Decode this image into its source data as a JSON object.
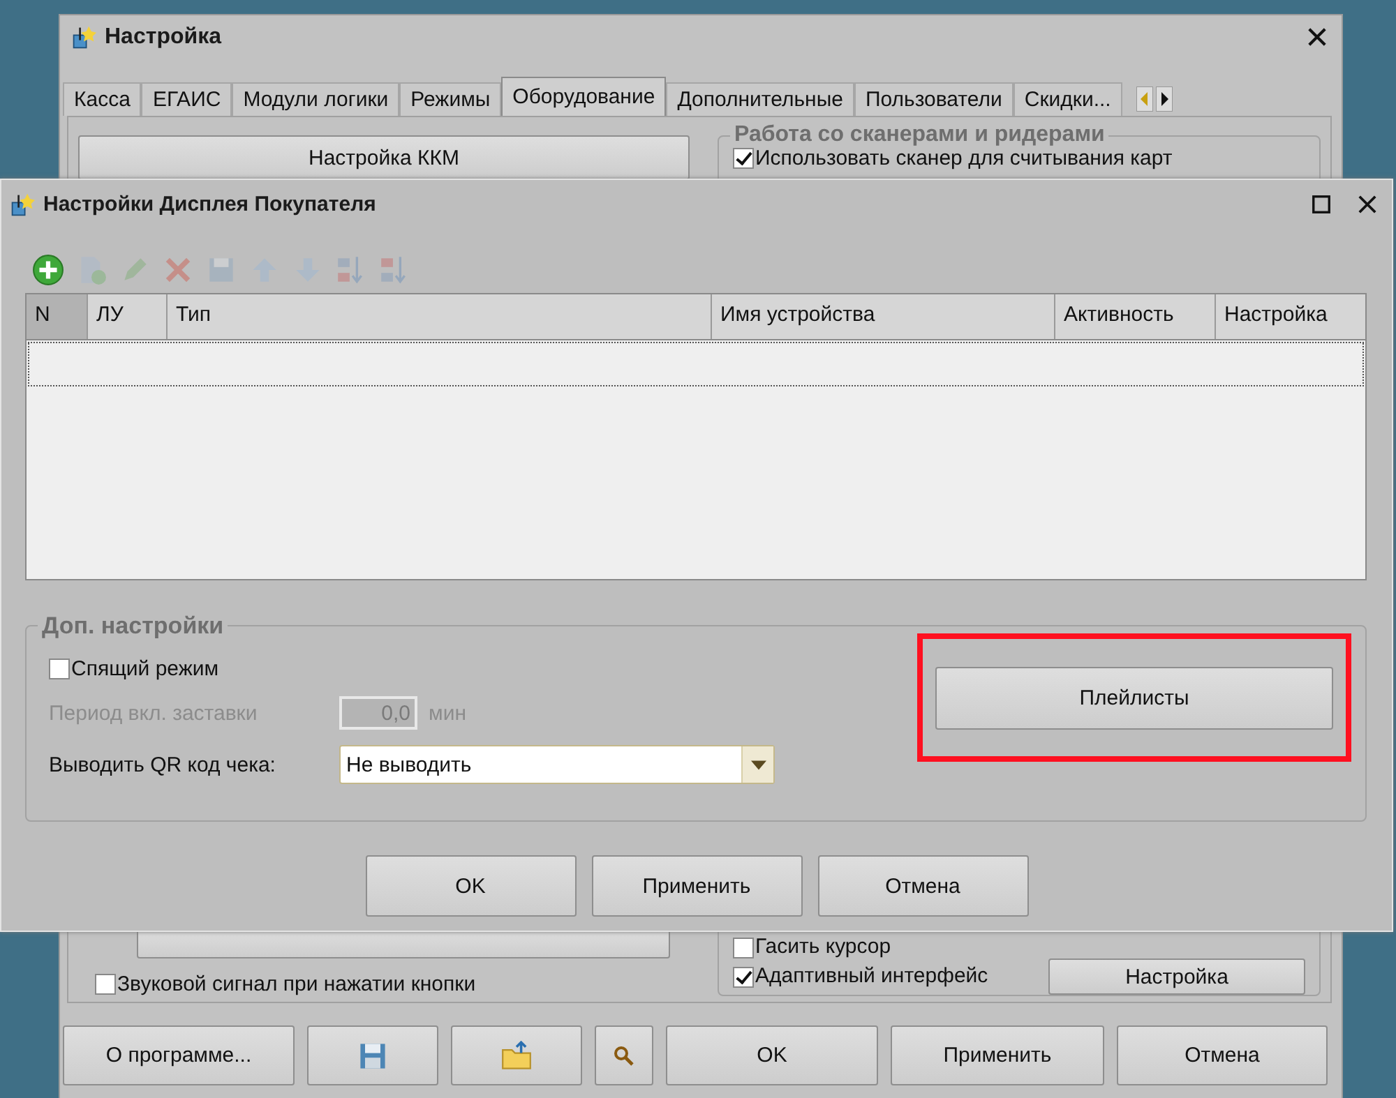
{
  "background_window": {
    "title": "Настройка",
    "tabs": [
      {
        "label": "Касса",
        "selected": false
      },
      {
        "label": "ЕГАИС",
        "selected": false
      },
      {
        "label": "Модули логики",
        "selected": false
      },
      {
        "label": "Режимы",
        "selected": false
      },
      {
        "label": "Оборудование",
        "selected": true
      },
      {
        "label": "Дополнительные",
        "selected": false
      },
      {
        "label": "Пользователи",
        "selected": false
      },
      {
        "label": "Скидки...",
        "selected": false
      }
    ],
    "kkm_button": "Настройка ККМ",
    "scanner_group": {
      "title": "Работа со сканерами и ридерами",
      "checkbox": {
        "label": "Использовать сканер для считывания карт",
        "checked": true
      }
    },
    "sound_checkbox": {
      "label": "Звуковой сигнал при нажатии кнопки",
      "checked": false
    },
    "cursor_checkbox": {
      "label": "Гасить курсор",
      "checked": false
    },
    "adaptive_checkbox": {
      "label": "Адаптивный интерфейс",
      "checked": true
    },
    "adaptive_settings_button": "Настройка",
    "buttons": [
      {
        "kind": "text",
        "label": "О программе..."
      },
      {
        "kind": "save"
      },
      {
        "kind": "folder"
      },
      {
        "kind": "search"
      },
      {
        "kind": "text",
        "label": "OK"
      },
      {
        "kind": "text",
        "label": "Применить"
      },
      {
        "kind": "text",
        "label": "Отмена"
      }
    ]
  },
  "dialog": {
    "title": "Настройки Дисплея Покупателя",
    "toolbar": [
      {
        "kind": "add",
        "disabled": false
      },
      {
        "kind": "copy",
        "disabled": true
      },
      {
        "kind": "edit",
        "disabled": true
      },
      {
        "kind": "delete",
        "disabled": true
      },
      {
        "kind": "save",
        "disabled": true
      },
      {
        "kind": "up",
        "disabled": true
      },
      {
        "kind": "down",
        "disabled": true
      },
      {
        "kind": "sort_asc",
        "disabled": true
      },
      {
        "kind": "sort_desc",
        "disabled": true
      }
    ],
    "columns": [
      {
        "label": "N",
        "selected": true
      },
      {
        "label": "ЛУ",
        "selected": false
      },
      {
        "label": "Тип",
        "selected": false
      },
      {
        "label": "Имя устройства",
        "selected": false
      },
      {
        "label": "Активность",
        "selected": false
      },
      {
        "label": "Настройка",
        "selected": false
      }
    ],
    "options": {
      "title": "Доп. настройки",
      "sleep_checkbox": {
        "label": "Спящий режим",
        "checked": false
      },
      "period": {
        "label": "Период вкл. заставки",
        "value": "0,0",
        "unit": "мин",
        "disabled": true
      },
      "qr": {
        "label": "Выводить QR код чека:",
        "value": "Не выводить"
      },
      "playlists_button": {
        "label": "Плейлисты",
        "highlighted": true
      }
    },
    "buttons": [
      "OK",
      "Применить",
      "Отмена"
    ]
  }
}
